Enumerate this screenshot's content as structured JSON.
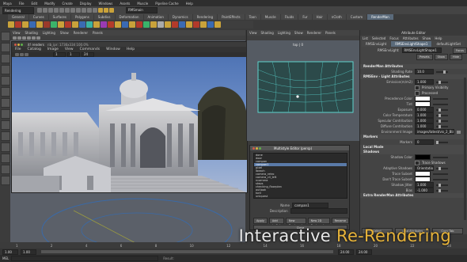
{
  "app": {
    "menubar": [
      "Maya",
      "File",
      "Edit",
      "Modify",
      "Create",
      "Display",
      "Windows",
      "Assets",
      "Muscle",
      "Pipeline Cache",
      "Help"
    ],
    "mode_select": "Rendering",
    "title": "RMSmain"
  },
  "shelf_tabs": [
    "General",
    "Curves",
    "Surfaces",
    "Polygons",
    "Subdivs",
    "Deformation",
    "Animation",
    "Dynamics",
    "Rendering",
    "PaintEffects",
    "Toon",
    "Muscle",
    "Fluids",
    "Fur",
    "Hair",
    "nCloth",
    "Custom",
    "RenderMan"
  ],
  "shelf_active": "RenderMan",
  "shelf_icon_colors": [
    "#c9a23a",
    "#b33a2a",
    "#c9a23a",
    "#3a6ab3",
    "#c9a23a",
    "#9a3a2a",
    "#3ab36a",
    "#c9a23a",
    "#b33a2a",
    "#c9a23a",
    "#3a6ab3",
    "#3ab3a2",
    "#c9a23a",
    "#9a3ab3",
    "#b33a2a",
    "#c9a23a",
    "#3a6ab3",
    "#c9a23a",
    "#b33a2a",
    "#3ab36a",
    "#c9a23a",
    "#aaaaaa",
    "#c9a23a",
    "#b33a2a",
    "#3a6ab3",
    "#c9a23a",
    "#b33a2a",
    "#c9a23a",
    "#3a6ab3",
    "#c9a23a"
  ],
  "left_toolbox_icons": [
    "select-icon",
    "lasso-icon",
    "paint-icon",
    "move-icon",
    "rotate-icon",
    "scale-icon",
    "manipulator-icon",
    "last-tool-icon",
    "layout-single-icon",
    "layout-four-icon",
    "layout-split-icon",
    "layout-outliner-icon",
    "layout-graph-icon",
    "layout-hypershade-icon"
  ],
  "main_viewport": {
    "menu": [
      "View",
      "Shading",
      "Lighting",
      "Show",
      "Renderer",
      "Panels"
    ]
  },
  "render_view": {
    "title": "it! renders",
    "subtitle": "rib_ipr: 1736x334 100.0%",
    "menu": [
      "File",
      "Catalog",
      "Image",
      "View",
      "Commands",
      "Window",
      "Help"
    ],
    "frame_fields": [
      "1",
      "1",
      "24"
    ]
  },
  "ortho_viewport": {
    "menu": [
      "View",
      "Shading",
      "Lighting",
      "Show",
      "Renderer",
      "Panels"
    ],
    "label": "top | 0"
  },
  "outliner": {
    "title": "Multistyle Editor (persp)",
    "items": [
      "done",
      "door",
      "campan",
      "campan1",
      "pixel",
      "ibeach",
      "camera_retro",
      "camera_cll_left",
      "ncamera",
      "steps",
      "checking_floorplan",
      "outlook",
      "toril",
      "uniquest"
    ],
    "selected_index": 3,
    "name_label": "Name",
    "name_value": "campan1",
    "description_label": "Description",
    "buttons": [
      "Apply",
      "Add to Sel",
      "New Bookmark",
      "New 2D Bookmark",
      "Rename"
    ],
    "close": "Close"
  },
  "attr_editor": {
    "title": "Attribute Editor",
    "menu": [
      "List",
      "Selected",
      "Focus",
      "Attributes",
      "Show",
      "Help"
    ],
    "node_tabs": [
      "RMSEnvLight",
      "RMSEnvLightShape1",
      "defaultLightSet"
    ],
    "node_label": "RMSEnvLight:",
    "node_value": "RMSEnvLightShape1",
    "focus_btn": "Focus",
    "presets_btn": "Presets",
    "show_btn": "Show",
    "hide_btn": "Hide",
    "sections": {
      "render_man": "RenderMan Attributes",
      "light_attrs": "RMSEnv - Light Attributes",
      "shadows": "Shadows",
      "markers": "Markers",
      "local_mode": "Local Mode",
      "extra": "Extra RenderMan Attributes"
    },
    "shading_rate": {
      "label": "Shading Rate",
      "value": "10.0"
    },
    "light_rows": [
      {
        "label": "Emission(m/m2)",
        "value": "1.000"
      },
      {
        "label": "",
        "value": "Primary Visibility"
      },
      {
        "label": "",
        "value": "Processed"
      },
      {
        "label": "Precedence Color",
        "value": ""
      },
      {
        "label": "Tint",
        "value": ""
      },
      {
        "label": "Exposure",
        "value": "0.000"
      },
      {
        "label": "Color Temperature",
        "value": "1.000"
      },
      {
        "label": "Specular Contribution",
        "value": "1.000"
      },
      {
        "label": "Diffuse Contribution",
        "value": "1.000"
      },
      {
        "label": "Environment Image",
        "value": "images/latest/vis_2_BlankBlinn.tex"
      }
    ],
    "markers_row": {
      "label": "Markers",
      "value": "0"
    },
    "shadow_rows": [
      {
        "label": "Shadow Color",
        "value": ""
      },
      {
        "label": "",
        "value": "Trace Shadows"
      },
      {
        "label": "Adaptive Shadows",
        "value": "Orientation"
      },
      {
        "label": "Trace Subset",
        "value": ""
      },
      {
        "label": "Don't Trace Subset",
        "value": ""
      },
      {
        "label": "Shadow Jitter",
        "value": "1.000"
      },
      {
        "label": "Bias",
        "value": "-1.000"
      }
    ],
    "bottom_buttons": [
      "Select",
      "Load Attributes",
      "Copy Tab"
    ]
  },
  "timeline": {
    "ticks": [
      "1",
      "2",
      "4",
      "6",
      "8",
      "10",
      "12",
      "14",
      "16",
      "18",
      "20",
      "22",
      "24"
    ],
    "start": "1.00",
    "end": "24.00",
    "range_start": "1.00",
    "range_end": "24.00"
  },
  "command_line": {
    "label": "MEL",
    "result": "Result:"
  },
  "caption": {
    "part1": "Interactive",
    "part2": "Re-Rendering",
    "color1": "#e8e8e8",
    "color2": "#e8b43a"
  }
}
